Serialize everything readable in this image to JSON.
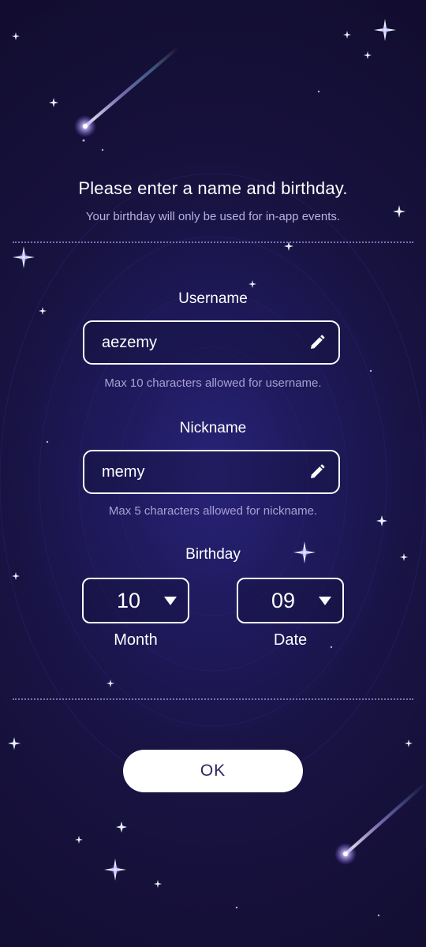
{
  "dialog": {
    "title": "Please enter a name and birthday.",
    "subtitle": "Your birthday will only be used for in-app events."
  },
  "username": {
    "label": "Username",
    "value": "aezemy",
    "hint": "Max 10 characters allowed for username.",
    "icon": "pencil-icon"
  },
  "nickname": {
    "label": "Nickname",
    "value": "memy",
    "hint": "Max 5 characters allowed for nickname.",
    "icon": "pencil-icon"
  },
  "birthday": {
    "label": "Birthday",
    "month": {
      "value": "10",
      "caption": "Month"
    },
    "date": {
      "value": "09",
      "caption": "Date"
    }
  },
  "ok_button": {
    "label": "OK"
  },
  "colors": {
    "background": "#17123a",
    "text": "#ffffff",
    "hint": "#a8a1d2",
    "divider": "#7a72b8",
    "button_text": "#2c2660"
  }
}
